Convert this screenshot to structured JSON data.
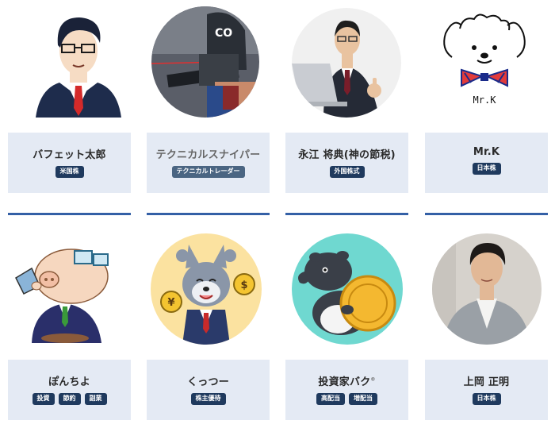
{
  "profiles": [
    {
      "name": "バフェット太郎",
      "tags": [
        "米国株"
      ],
      "avatar": "cartoon-businessman-glasses-red-tie",
      "muted": false
    },
    {
      "name": "テクニカルスナイパー",
      "tags": [
        "テクニカルトレーダー"
      ],
      "avatar": "sniper-with-rifle-photo",
      "muted": true
    },
    {
      "name": "永江 将典(神の節税)",
      "tags": [
        "外国株式"
      ],
      "avatar": "businessman-laptop-thumbs-up-photo",
      "muted": false
    },
    {
      "name": "Mr.K",
      "tags": [
        "日本株"
      ],
      "avatar": "dog-with-bowtie-illustration",
      "avatar_caption": "Mr.K",
      "muted": false
    },
    {
      "name": "ぽんちよ",
      "tags": [
        "投資",
        "節約",
        "副業"
      ],
      "avatar": "pig-with-glasses-laptop-illustration",
      "muted": false
    },
    {
      "name": "くっつー",
      "tags": [
        "株主優待"
      ],
      "avatar": "wolf-in-suit-with-coins-illustration",
      "muted": false
    },
    {
      "name": "投資家バク",
      "name_mark": "®",
      "tags": [
        "高配当",
        "増配当"
      ],
      "avatar": "tapir-with-gold-coin-illustration",
      "muted": false
    },
    {
      "name": "上岡 正明",
      "tags": [
        "日本株"
      ],
      "avatar": "man-in-grey-jacket-photo",
      "muted": false
    }
  ],
  "colors": {
    "card_bg": "#e4eaf4",
    "tag_bg": "#1f3a5e",
    "divider": "#3460a6"
  }
}
